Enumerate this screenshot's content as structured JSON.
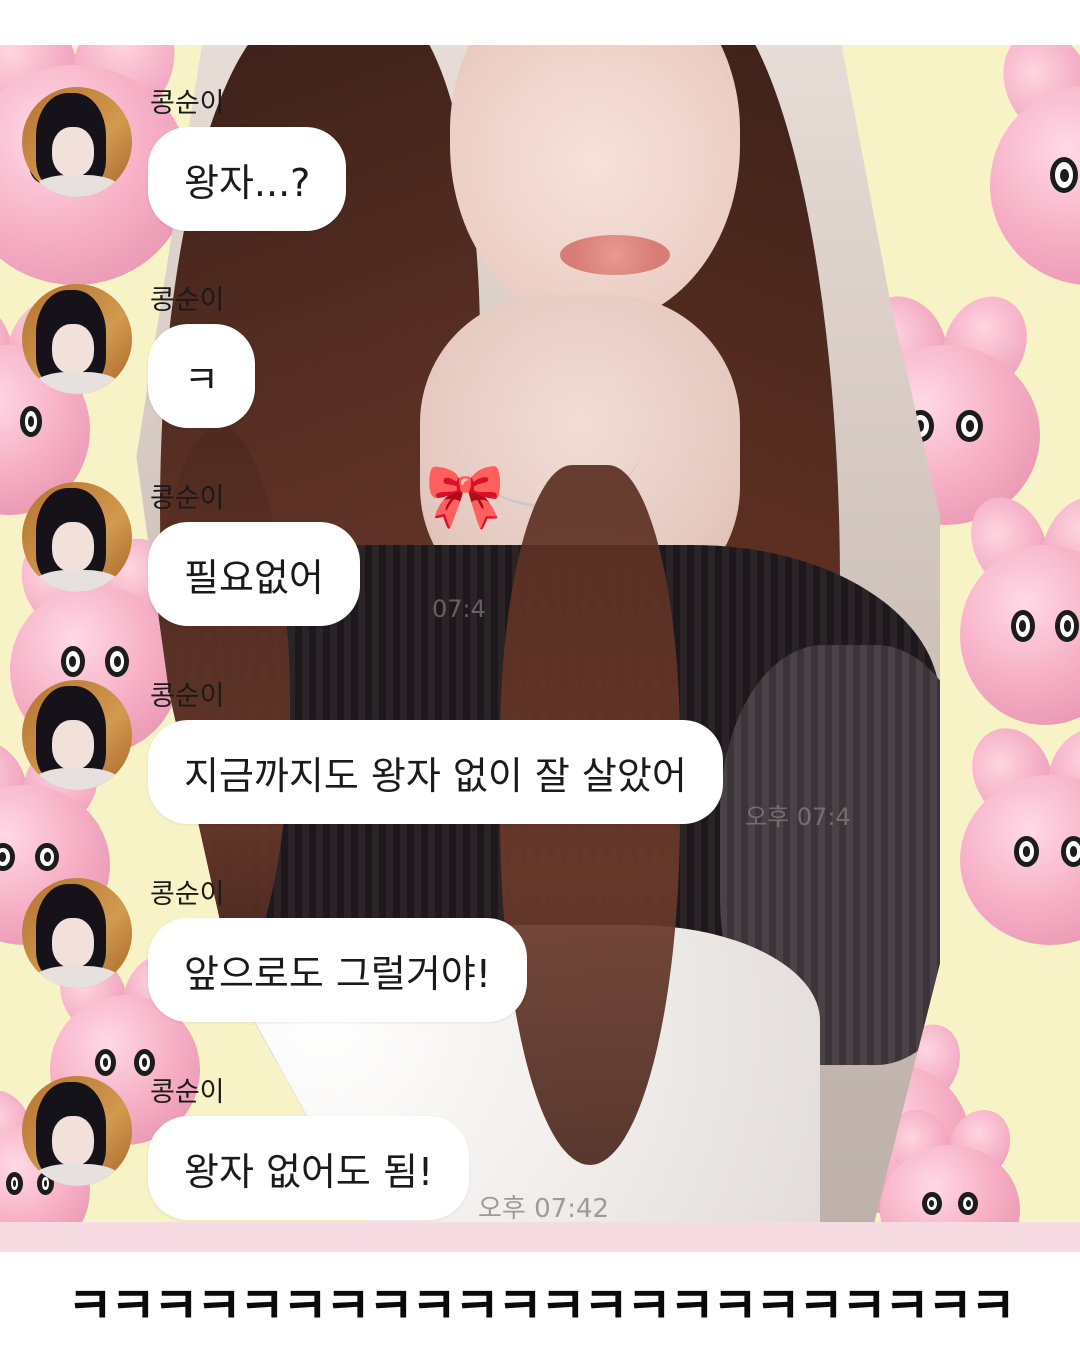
{
  "chat": {
    "messages": [
      {
        "sender": "콩순이",
        "text": "왕자...?"
      },
      {
        "sender": "콩순이",
        "text": "ㅋ"
      },
      {
        "sender": "콩순이",
        "text": "필요없어"
      },
      {
        "sender": "콩순이",
        "text": "지금까지도 왕자 없이 잘 살았어"
      },
      {
        "sender": "콩순이",
        "text": "앞으로도 그럴거야!"
      },
      {
        "sender": "콩순이",
        "text": "왕자 없어도 됨!"
      }
    ],
    "last_timestamp": "오후 07:42",
    "ghost_timestamps": [
      "07:4",
      "오후 07:4"
    ]
  },
  "caption": "ㅋㅋㅋㅋㅋㅋㅋㅋㅋㅋㅋㅋㅋㅋㅋㅋㅋㅋㅋㅋㅋㅋ",
  "colors": {
    "background": "#f8f3c7",
    "bubble": "#ffffff",
    "bunny": "#f7b2c8",
    "bottom_strip": "#f6dce2",
    "caption_text": "#0a0a0a"
  },
  "icons": {
    "avatar": "profile-photo",
    "background_character": "pink-bunny-character"
  }
}
